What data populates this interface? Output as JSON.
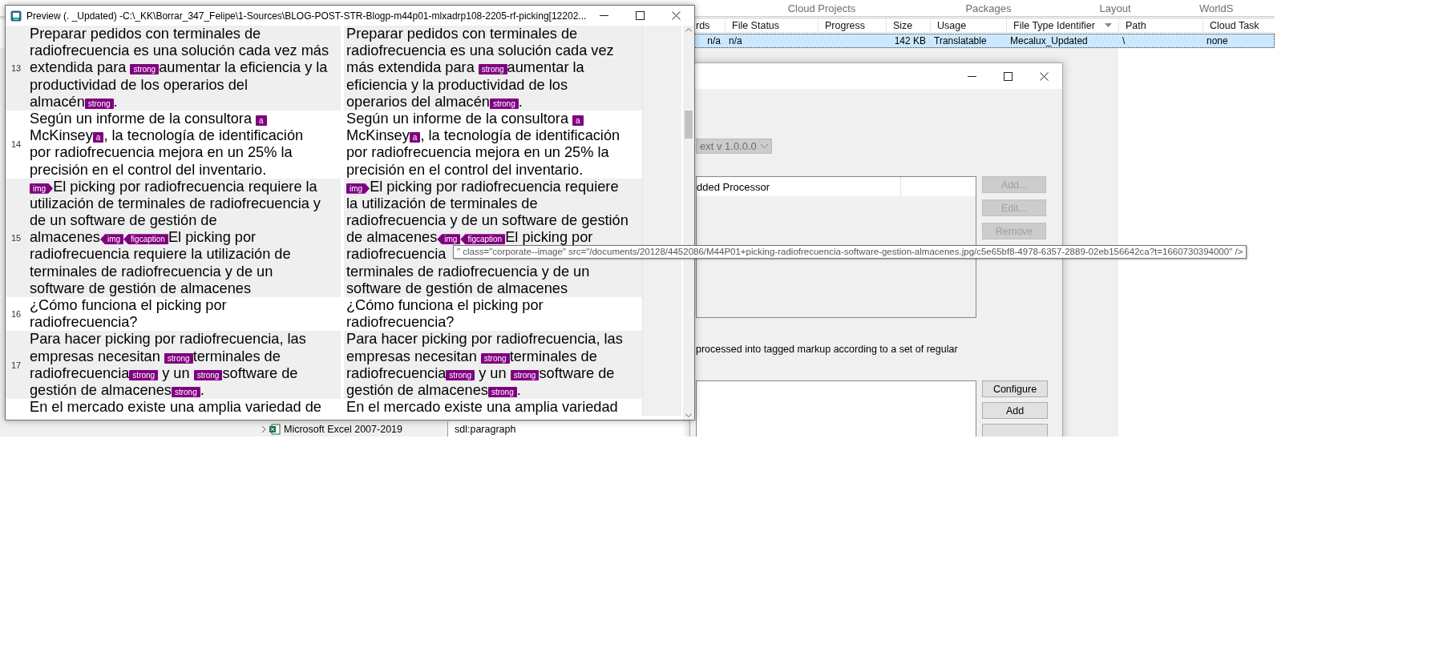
{
  "main_window": {
    "ribbon_groups": [
      "Cloud Projects",
      "Packages",
      "Layout",
      "WorldS"
    ],
    "file_table": {
      "columns": [
        {
          "label": "rds",
          "sorted": false
        },
        {
          "label": "File Status",
          "sorted": false
        },
        {
          "label": "Progress",
          "sorted": false
        },
        {
          "label": "Size",
          "sorted": false
        },
        {
          "label": "Usage",
          "sorted": false
        },
        {
          "label": "File Type Identifier",
          "sorted": true
        },
        {
          "label": "Path",
          "sorted": false
        },
        {
          "label": "Cloud Task",
          "sorted": false
        }
      ],
      "rows": [
        {
          "selected": true,
          "column_1": "n/a",
          "file_status": "n/a",
          "size": "142 KB",
          "usage": "Translatable",
          "file_type_identifier": "Mecalux_Updated",
          "path": "\\",
          "cloud_task": "none"
        }
      ]
    },
    "tree_item": "Microsoft Excel 2007-2019",
    "rule_item": "sdl:paragraph"
  },
  "dialog": {
    "dropdown": {
      "value": "ext v 1.0.0.0",
      "disabled": true
    },
    "processors": [
      "dded Processor"
    ],
    "side_buttons": [
      {
        "label": "Add...",
        "disabled": true
      },
      {
        "label": "Edit...",
        "disabled": true
      },
      {
        "label": "Remove",
        "disabled": true
      }
    ],
    "description": "processed into tagged markup according to a set of regular",
    "rule_buttons": [
      {
        "label": "Configure",
        "disabled": false
      },
      {
        "label": "Add",
        "disabled": false
      }
    ]
  },
  "preview_window": {
    "title": "Preview (. _Updated) -C:\\_KK\\Borrar_347_Felipe\\1-Sources\\BLOG-POST-STR-Blogp-m44p01-mlxadrp108-2205-rf-picking[12202...",
    "rows": [
      {
        "number": "13",
        "source": [
          [
            {
              "kind": "text",
              "text": "Preparar pedidos con terminales de"
            }
          ],
          [
            {
              "kind": "text",
              "text": "radiofrecuencia es una solución cada vez más"
            }
          ],
          [
            {
              "kind": "text",
              "text": "extendida para "
            },
            {
              "kind": "tag",
              "text": "strong"
            },
            {
              "kind": "text",
              "text": "aumentar la eficiencia y la"
            }
          ],
          [
            {
              "kind": "text",
              "text": "productividad de los operarios del"
            }
          ],
          [
            {
              "kind": "text",
              "text": "almacén"
            },
            {
              "kind": "tag",
              "text": "strong"
            },
            {
              "kind": "text",
              "text": "."
            }
          ]
        ],
        "target": [
          [
            {
              "kind": "text",
              "text": "Preparar pedidos con terminales de"
            }
          ],
          [
            {
              "kind": "text",
              "text": "radiofrecuencia es una solución cada vez"
            }
          ],
          [
            {
              "kind": "text",
              "text": "más extendida para "
            },
            {
              "kind": "tag",
              "text": "strong"
            },
            {
              "kind": "text",
              "text": "aumentar la"
            }
          ],
          [
            {
              "kind": "text",
              "text": "eficiencia y la productividad de los"
            }
          ],
          [
            {
              "kind": "text",
              "text": "operarios del almacén"
            },
            {
              "kind": "tag",
              "text": "strong"
            },
            {
              "kind": "text",
              "text": "."
            }
          ]
        ]
      },
      {
        "number": "14",
        "source": [
          [
            {
              "kind": "text",
              "text": "Según un informe de la consultora "
            },
            {
              "kind": "tag",
              "text": "a"
            }
          ],
          [
            {
              "kind": "text",
              "text": "McKinsey"
            },
            {
              "kind": "tag",
              "text": "a"
            },
            {
              "kind": "text",
              "text": ", la tecnología de identificación"
            }
          ],
          [
            {
              "kind": "text",
              "text": "por radiofrecuencia mejora en un 25% la"
            }
          ],
          [
            {
              "kind": "text",
              "text": "precisión en el control del inventario."
            }
          ]
        ],
        "target": [
          [
            {
              "kind": "text",
              "text": "Según un informe de la consultora "
            },
            {
              "kind": "tag",
              "text": "a"
            }
          ],
          [
            {
              "kind": "text",
              "text": "McKinsey"
            },
            {
              "kind": "tag",
              "text": "a"
            },
            {
              "kind": "text",
              "text": ", la tecnología de identificación"
            }
          ],
          [
            {
              "kind": "text",
              "text": "por radiofrecuencia mejora en un 25% la"
            }
          ],
          [
            {
              "kind": "text",
              "text": "precisión en el control del inventario."
            }
          ]
        ]
      },
      {
        "number": "15",
        "source": [
          [
            {
              "kind": "tag_open",
              "text": "img"
            },
            {
              "kind": "text",
              "text": "El picking por radiofrecuencia requiere la"
            }
          ],
          [
            {
              "kind": "text",
              "text": "utilización de terminales de radiofrecuencia y"
            }
          ],
          [
            {
              "kind": "text",
              "text": "de un software de gestión de"
            }
          ],
          [
            {
              "kind": "text",
              "text": "almacenes"
            },
            {
              "kind": "tag_close",
              "text": "img"
            },
            {
              "kind": "tag_close",
              "text": "figcaption"
            },
            {
              "kind": "text",
              "text": "El picking por"
            }
          ],
          [
            {
              "kind": "text",
              "text": "radiofrecuencia requiere la utilización de"
            }
          ],
          [
            {
              "kind": "text",
              "text": "terminales de radiofrecuencia y de un"
            }
          ],
          [
            {
              "kind": "text",
              "text": "software de gestión de almacenes"
            }
          ]
        ],
        "target": [
          [
            {
              "kind": "tag_open",
              "text": "img"
            },
            {
              "kind": "text",
              "text": "El picking por radiofrecuencia requiere"
            }
          ],
          [
            {
              "kind": "text",
              "text": "la utilización de terminales de"
            }
          ],
          [
            {
              "kind": "text",
              "text": "radiofrecuencia y de un software de gestión"
            }
          ],
          [
            {
              "kind": "text",
              "text": "de almacenes"
            },
            {
              "kind": "tag_close",
              "text": "img"
            },
            {
              "kind": "tag_close",
              "text": "figcaption"
            },
            {
              "kind": "text",
              "text": "El picking por"
            }
          ],
          [
            {
              "kind": "text",
              "text": "radiofrecuencia"
            },
            {
              "kind": "covered"
            }
          ],
          [
            {
              "kind": "text",
              "text": "terminales de radiofrecuencia y de un"
            }
          ],
          [
            {
              "kind": "text",
              "text": "software de gestión de almacenes"
            }
          ]
        ]
      },
      {
        "number": "16",
        "source": [
          [
            {
              "kind": "text",
              "text": "¿Cómo funciona el picking por"
            }
          ],
          [
            {
              "kind": "text",
              "text": "radiofrecuencia?"
            }
          ]
        ],
        "target": [
          [
            {
              "kind": "text",
              "text": "¿Cómo funciona el picking por"
            }
          ],
          [
            {
              "kind": "text",
              "text": "radiofrecuencia?"
            }
          ]
        ]
      },
      {
        "number": "17",
        "source": [
          [
            {
              "kind": "text",
              "text": "Para hacer picking por radiofrecuencia, las"
            }
          ],
          [
            {
              "kind": "text",
              "text": "empresas necesitan "
            },
            {
              "kind": "tag",
              "text": "strong"
            },
            {
              "kind": "text",
              "text": "terminales de"
            }
          ],
          [
            {
              "kind": "text",
              "text": "radiofrecuencia"
            },
            {
              "kind": "tag",
              "text": "strong"
            },
            {
              "kind": "text",
              "text": " y un "
            },
            {
              "kind": "tag",
              "text": "strong"
            },
            {
              "kind": "text",
              "text": "software de"
            }
          ],
          [
            {
              "kind": "text",
              "text": "gestión de almacenes"
            },
            {
              "kind": "tag",
              "text": "strong"
            },
            {
              "kind": "text",
              "text": "."
            }
          ]
        ],
        "target": [
          [
            {
              "kind": "text",
              "text": "Para hacer picking por radiofrecuencia, las"
            }
          ],
          [
            {
              "kind": "text",
              "text": "empresas necesitan "
            },
            {
              "kind": "tag",
              "text": "strong"
            },
            {
              "kind": "text",
              "text": "terminales de"
            }
          ],
          [
            {
              "kind": "text",
              "text": "radiofrecuencia"
            },
            {
              "kind": "tag",
              "text": "strong"
            },
            {
              "kind": "text",
              "text": " y un "
            },
            {
              "kind": "tag",
              "text": "strong"
            },
            {
              "kind": "text",
              "text": "software de"
            }
          ],
          [
            {
              "kind": "text",
              "text": "gestión de almacenes"
            },
            {
              "kind": "tag",
              "text": "strong"
            },
            {
              "kind": "text",
              "text": "."
            }
          ]
        ]
      },
      {
        "source": [
          [
            {
              "kind": "text",
              "text": "En el mercado existe una amplia variedad de"
            }
          ]
        ],
        "target": [
          [
            {
              "kind": "text",
              "text": "En el mercado existe una amplia variedad"
            }
          ]
        ]
      }
    ]
  },
  "tooltip": {
    "text": "\" class=\"corporate--image\" src=\"/documents/20128/4452086/M44P01+picking-radiofrecuencia-software-gestion-almacenes.jpg/c5e65bf8-4978-6357-2889-02eb156642ca?t=1660730394000\" />"
  }
}
